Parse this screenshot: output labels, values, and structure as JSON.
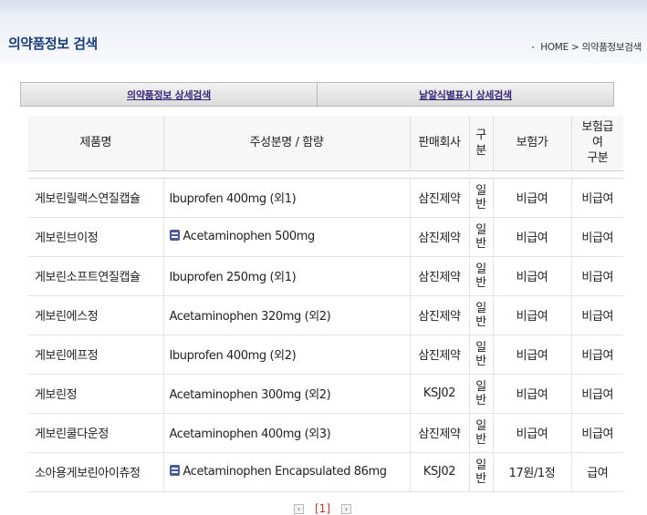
{
  "header": {
    "title": "의약품정보 검색",
    "breadcrumb_bullet": "•",
    "breadcrumb": "HOME > 의약품정보검색"
  },
  "tabs": [
    {
      "label": "의약품정보 상세검색"
    },
    {
      "label": "낱알식별표시 상세검색"
    }
  ],
  "table": {
    "headers": [
      "제품명",
      "주성분명 / 함량",
      "판매회사",
      "구\n분",
      "보험가",
      "보험급\n여\n구분"
    ],
    "rows": [
      {
        "name": "게보린릴랙스연질캡슐",
        "icon": false,
        "ingredient": "Ibuprofen 400mg (외1)",
        "company": "삼진제약",
        "gubun": "일\n반",
        "price": "비급여",
        "coverage": "비급여"
      },
      {
        "name": "게보린브이정",
        "icon": true,
        "ingredient": "Acetaminophen 500mg",
        "company": "삼진제약",
        "gubun": "일\n반",
        "price": "비급여",
        "coverage": "비급여"
      },
      {
        "name": "게보린소프트연질캡슐",
        "icon": false,
        "ingredient": "Ibuprofen 250mg (외1)",
        "company": "삼진제약",
        "gubun": "일\n반",
        "price": "비급여",
        "coverage": "비급여"
      },
      {
        "name": "게보린에스정",
        "icon": false,
        "ingredient": "Acetaminophen 320mg (외2)",
        "company": "삼진제약",
        "gubun": "일\n반",
        "price": "비급여",
        "coverage": "비급여"
      },
      {
        "name": "게보린에프정",
        "icon": false,
        "ingredient": "Ibuprofen 400mg (외2)",
        "company": "삼진제약",
        "gubun": "일\n반",
        "price": "비급여",
        "coverage": "비급여"
      },
      {
        "name": "게보린정",
        "icon": false,
        "ingredient": "Acetaminophen 300mg (외2)",
        "company": "KSJ02",
        "gubun": "일\n반",
        "price": "비급여",
        "coverage": "비급여"
      },
      {
        "name": "게보린쿨다운정",
        "icon": false,
        "ingredient": "Acetaminophen 400mg (외3)",
        "company": "삼진제약",
        "gubun": "일\n반",
        "price": "비급여",
        "coverage": "비급여"
      },
      {
        "name": "소아용게보린아이츄정",
        "icon": true,
        "ingredient": "Acetaminophen Encapsulated 86mg",
        "company": "KSJ02",
        "gubun": "일\n반",
        "price": "17원/1정",
        "coverage": "급여"
      }
    ]
  },
  "pager": {
    "prev_label": "‹",
    "current_page": "[1]",
    "next_label": "›"
  },
  "icons": {
    "doc": "document-icon"
  },
  "colors": {
    "title": "#1d3f7a",
    "tab_text": "#3a2a7a",
    "current_page": "#c0392b",
    "doc_icon": "#4a5a9c"
  }
}
